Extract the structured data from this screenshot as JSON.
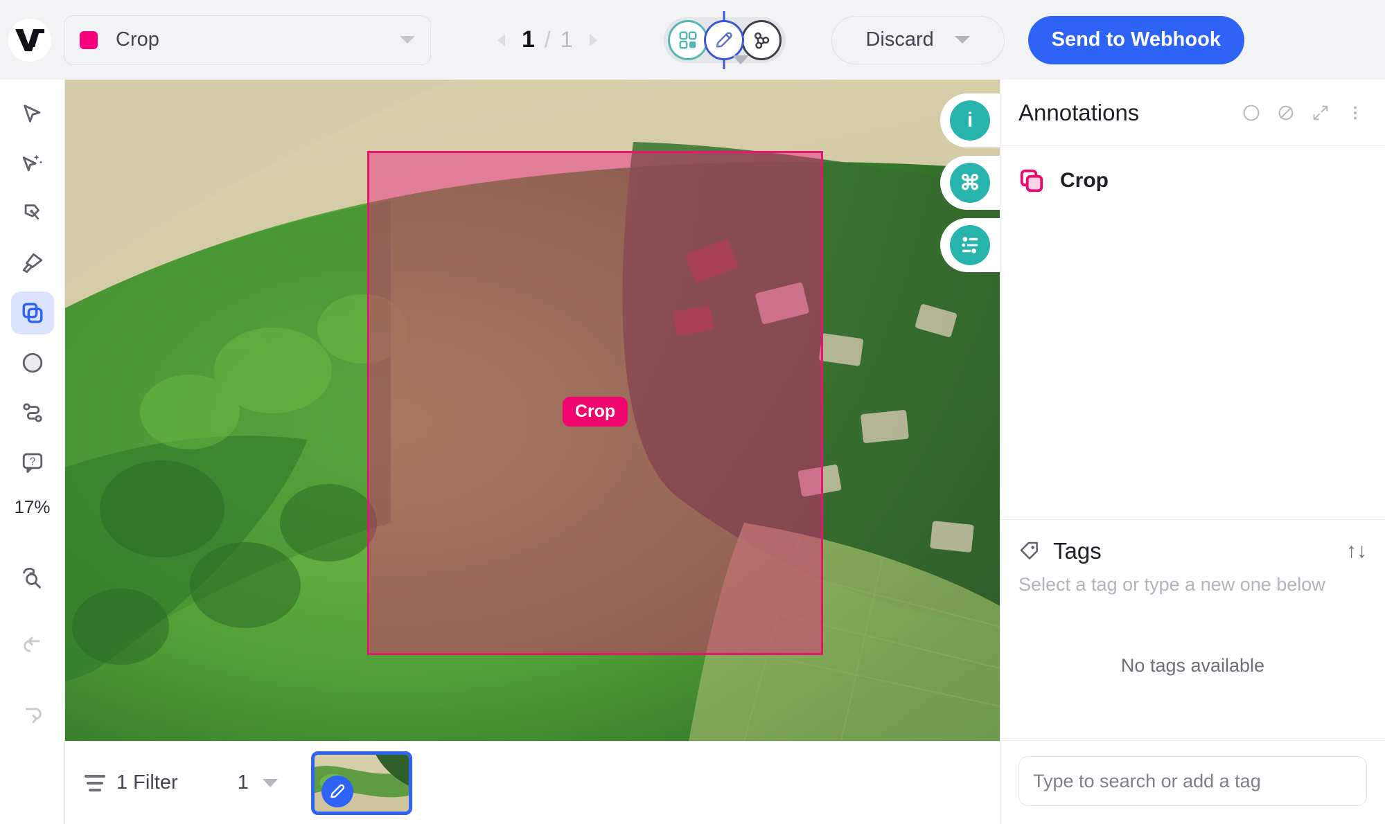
{
  "topbar": {
    "logo_name": "v7-logo",
    "class_selector": {
      "label": "Crop",
      "swatch_color": "#f8007d"
    },
    "pager": {
      "current": "1",
      "separator": "/",
      "total": "1"
    },
    "stages": [
      {
        "name": "dataset-stage",
        "icon": "grid-icon",
        "color": "#54b8b0",
        "active": false
      },
      {
        "name": "annotate-stage",
        "icon": "pencil-icon",
        "color": "#3c56d6",
        "active": true
      },
      {
        "name": "webhook-stage",
        "icon": "webhook-icon",
        "color": "#3c4048",
        "active": false
      }
    ],
    "discard_label": "Discard",
    "send_webhook_label": "Send to Webhook",
    "accent_blue": "#2f63f5"
  },
  "left_toolbar": {
    "tools": [
      {
        "name": "select-tool",
        "icon": "cursor-arrow-icon",
        "active": false
      },
      {
        "name": "auto-annotate-tool",
        "icon": "magic-cursor-icon",
        "active": false
      },
      {
        "name": "polygon-pen-tool",
        "icon": "pen-icon",
        "active": false
      },
      {
        "name": "brush-tool",
        "icon": "brush-icon",
        "active": false
      },
      {
        "name": "bounding-box-tool",
        "icon": "bounding-box-icon",
        "active": true
      },
      {
        "name": "ellipse-tool",
        "icon": "ellipse-icon",
        "active": false
      },
      {
        "name": "keypoint-skeleton-tool",
        "icon": "skeleton-icon",
        "active": false
      },
      {
        "name": "attributes-tool",
        "icon": "question-bubble-icon",
        "active": false
      }
    ],
    "zoom_level": "17%",
    "bottom_tools": [
      {
        "name": "reset-zoom-tool",
        "icon": "zoom-reset-icon"
      },
      {
        "name": "undo-button",
        "icon": "undo-arrow-icon"
      },
      {
        "name": "redo-button",
        "icon": "redo-arrow-icon"
      }
    ]
  },
  "canvas": {
    "annotation": {
      "label": "Crop",
      "fill_color": "rgba(242,20,128,0.42)",
      "stroke_color": "#e8156f",
      "pill_color": "#f0046e"
    },
    "floating_buttons": [
      {
        "name": "info-button",
        "icon": "info-icon",
        "glyph": "i"
      },
      {
        "name": "shortcuts-button",
        "icon": "command-key-icon",
        "glyph": "⌘"
      },
      {
        "name": "settings-button",
        "icon": "sliders-icon",
        "glyph": ""
      }
    ],
    "float_color": "#27b4ad"
  },
  "bottombar": {
    "filter_label": "1 Filter",
    "item_count": "1",
    "thumbnail": {
      "name": "image-thumbnail",
      "badge_icon": "pencil-icon",
      "selected": true
    }
  },
  "right_panel": {
    "annotations": {
      "title": "Annotations",
      "header_icons": [
        {
          "name": "circle-toggle-icon",
          "icon": "circle-icon"
        },
        {
          "name": "hide-annotations-icon",
          "icon": "circle-slash-icon"
        },
        {
          "name": "expand-panel-icon",
          "icon": "expand-arrows-icon"
        },
        {
          "name": "more-options-icon",
          "icon": "vertical-dots-icon"
        }
      ],
      "items": [
        {
          "label": "Crop",
          "color": "#f0046e",
          "shape": "bounding-box-icon"
        }
      ]
    },
    "tags": {
      "title": "Tags",
      "icon": "tag-icon",
      "sort_icon": "sort-arrows-icon",
      "sort_glyph": "↑↓",
      "hint": "Select a tag or type a new one below",
      "empty_text": "No tags available",
      "input_placeholder": "Type to search or add a tag",
      "input_value": ""
    }
  }
}
